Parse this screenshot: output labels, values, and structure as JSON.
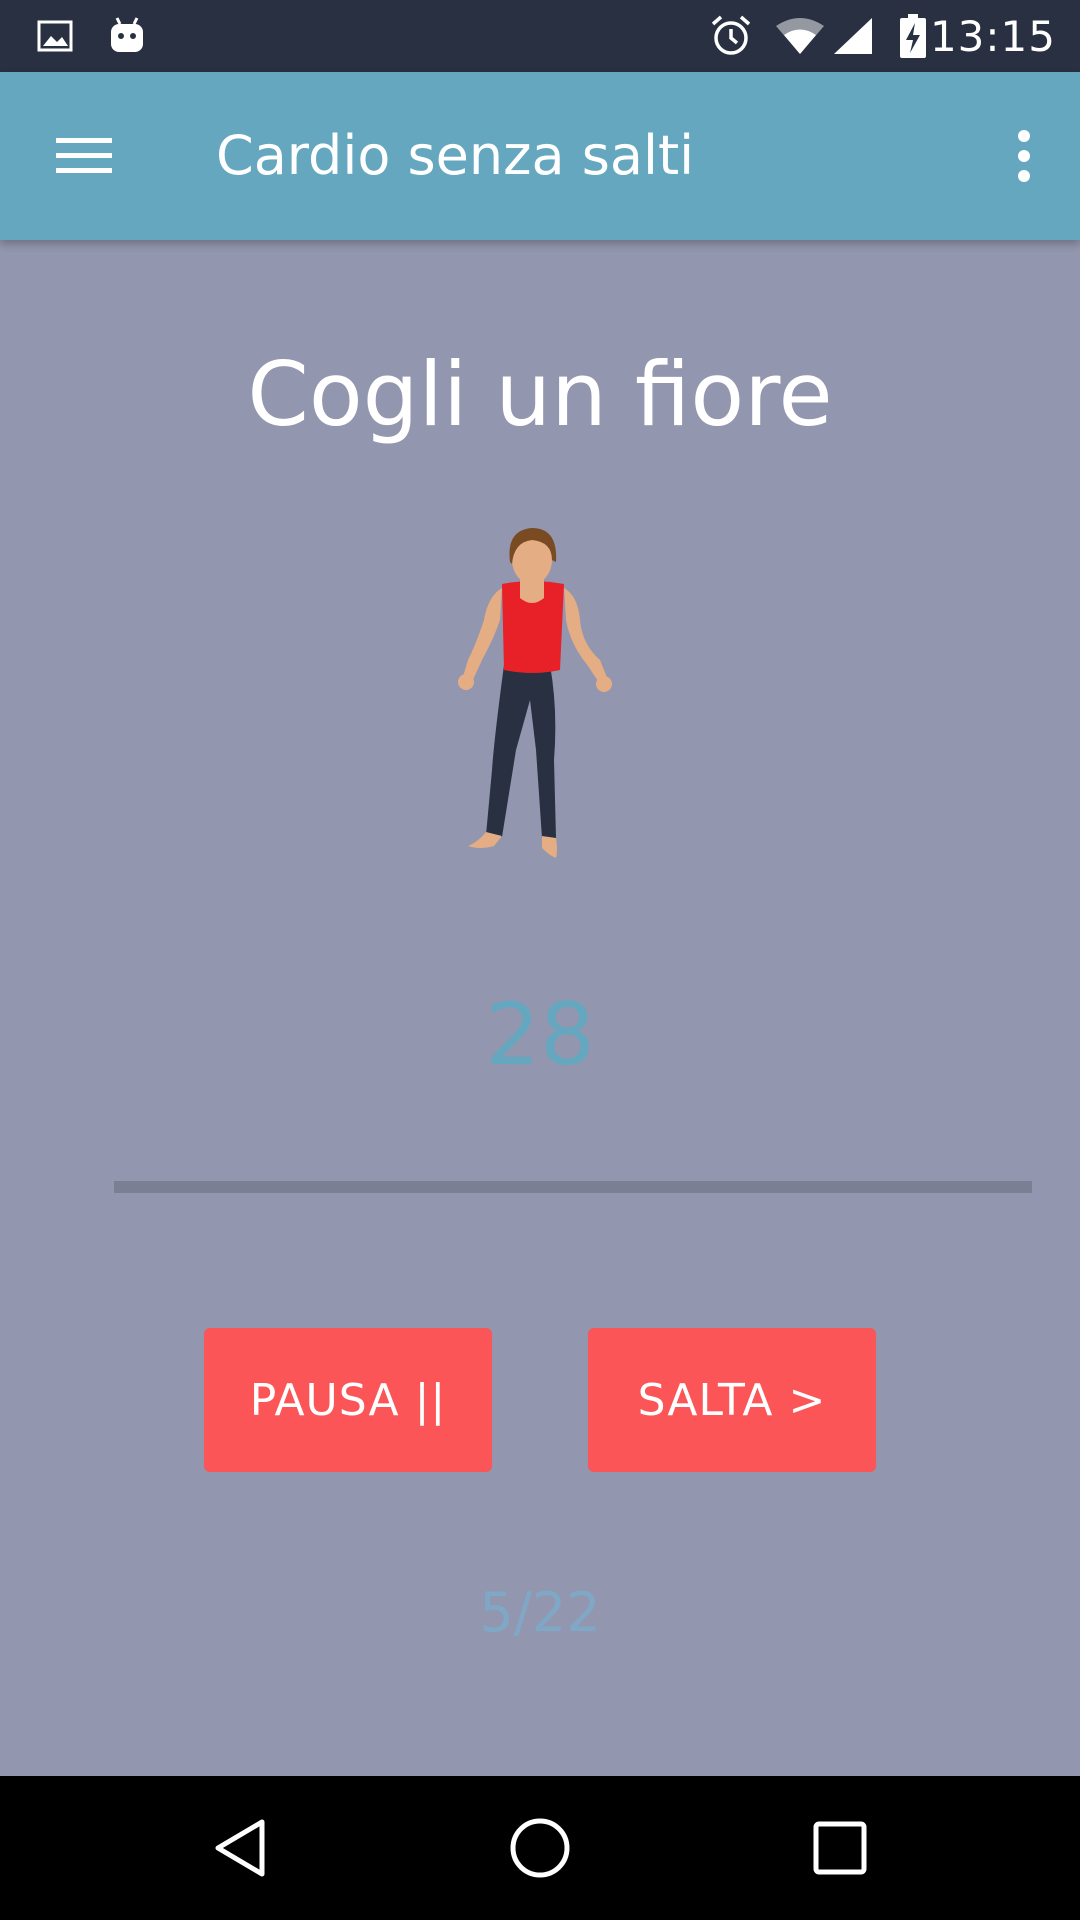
{
  "status_bar": {
    "time": "13:15",
    "icons": [
      "image-icon",
      "android-icon",
      "alarm-icon",
      "wifi-icon",
      "signal-icon",
      "battery-charging-icon"
    ]
  },
  "app_bar": {
    "title": "Cardio senza salti",
    "menu_icon": "hamburger-menu-icon",
    "overflow_icon": "more-vert-icon"
  },
  "exercise": {
    "name": "Cogli un fiore",
    "countdown": "28",
    "progress": 0.0
  },
  "controls": {
    "pause_label": "PAUSA ||",
    "skip_label": "SALTA >"
  },
  "counter": "5/22",
  "nav_bar": {
    "icons": [
      "back-icon",
      "home-icon",
      "recents-icon"
    ]
  },
  "colors": {
    "status_bar": "#283041",
    "app_bar": "#66a7c0",
    "background": "#9396af",
    "button": "#fc5558",
    "accent": "#66a7c0",
    "nav_bar": "#000000"
  }
}
